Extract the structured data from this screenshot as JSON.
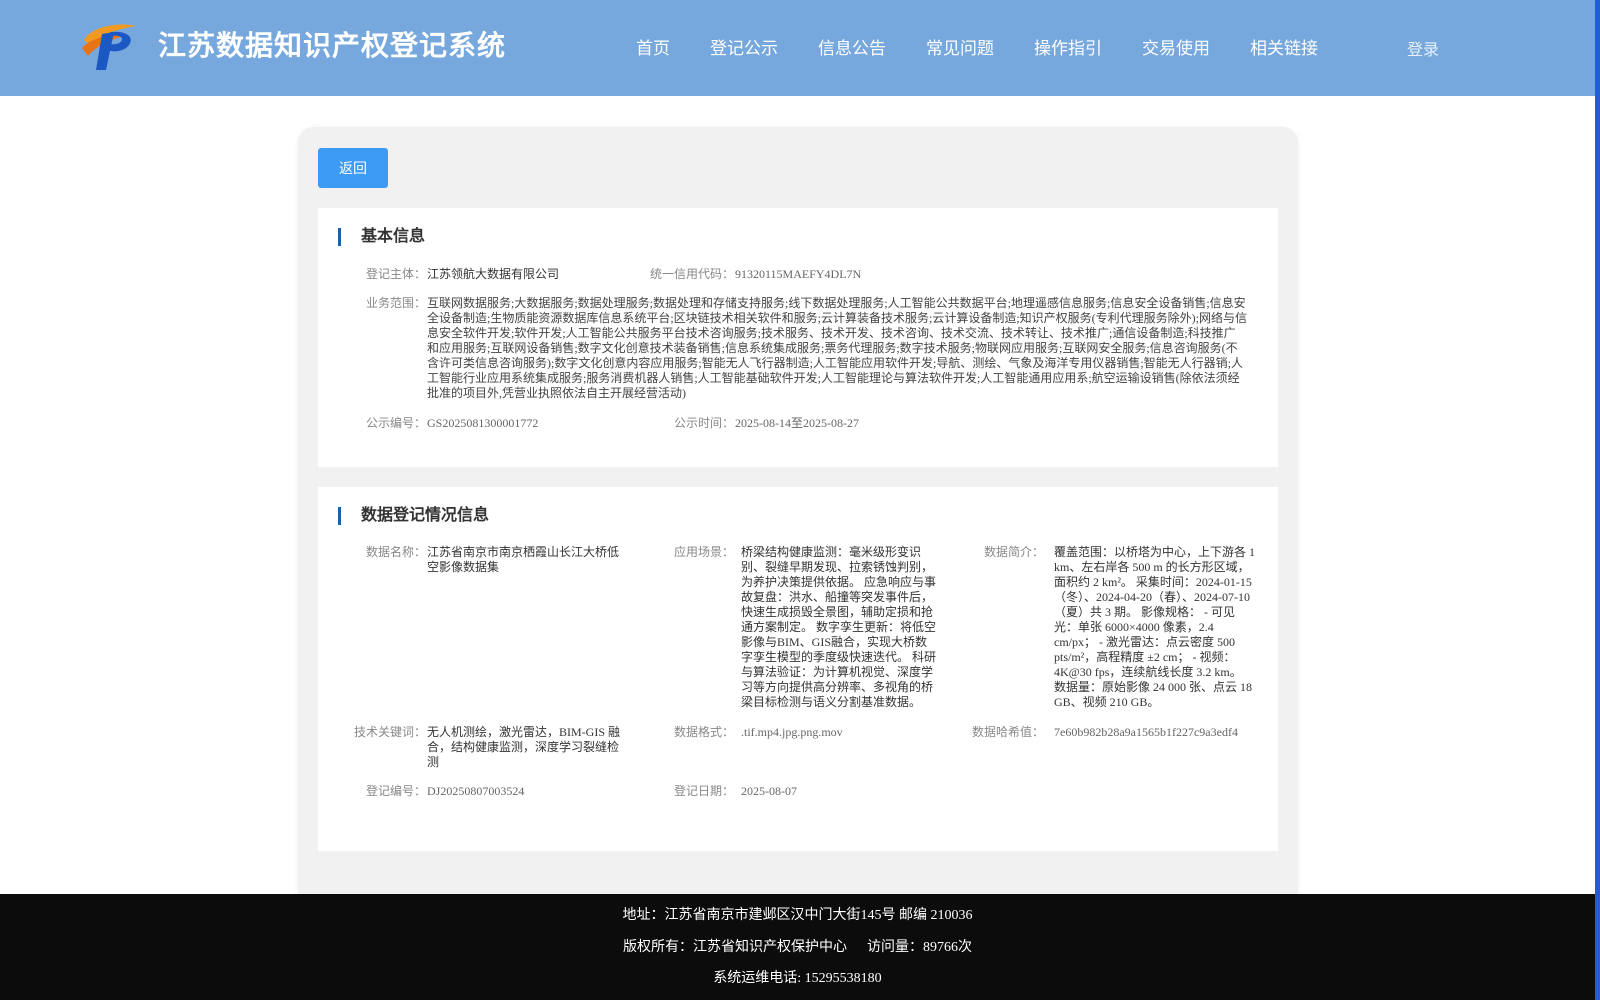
{
  "header": {
    "title": "江苏数据知识产权登记系统",
    "nav": [
      "首页",
      "登记公示",
      "信息公告",
      "常见问题",
      "操作指引",
      "交易使用",
      "相关链接"
    ],
    "login": "登录"
  },
  "back_button": "返回",
  "basic_info": {
    "title": "基本信息",
    "subject_label": "登记主体：",
    "subject_value": "江苏领航大数据有限公司",
    "credit_label": "统一信用代码：",
    "credit_value": "91320115MAEFY4DL7N",
    "scope_label": "业务范围：",
    "scope_value": "互联网数据服务;大数据服务;数据处理服务;数据处理和存储支持服务;线下数据处理服务;人工智能公共数据平台;地理遥感信息服务;信息安全设备销售;信息安全设备制造;生物质能资源数据库信息系统平台;区块链技术相关软件和服务;云计算装备技术服务;云计算设备制造;知识产权服务(专利代理服务除外);网络与信息安全软件开发;软件开发;人工智能公共服务平台技术咨询服务;技术服务、技术开发、技术咨询、技术交流、技术转让、技术推广;通信设备制造;科技推广和应用服务;互联网设备销售;数字文化创意技术装备销售;信息系统集成服务;票务代理服务;数字技术服务;物联网应用服务;互联网安全服务;信息咨询服务(不含许可类信息咨询服务);数字文化创意内容应用服务;智能无人飞行器制造;人工智能应用软件开发;导航、测绘、气象及海洋专用仪器销售;智能无人行器销;人工智能行业应用系统集成服务;服务消费机器人销售;人工智能基础软件开发;人工智能理论与算法软件开发;人工智能通用应用系;航空运输设销售(除依法须经批准的项目外,凭营业执照依法自主开展经营活动)",
    "notice_no_label": "公示编号：",
    "notice_no_value": "GS2025081300001772",
    "notice_time_label": "公示时间：",
    "notice_time_value": "2025-08-14至2025-08-27"
  },
  "registration_info": {
    "title": "数据登记情况信息",
    "name_label": "数据名称：",
    "name_value": "江苏省南京市南京栖霞山长江大桥低空影像数据集",
    "scenario_label": "应用场景：",
    "scenario_value": "桥梁结构健康监测：毫米级形变识别、裂缝早期发现、拉索锈蚀判别，为养护决策提供依据。 应急响应与事故复盘：洪水、船撞等突发事件后，快速生成损毁全景图，辅助定损和抢通方案制定。 数字孪生更新：将低空影像与BIM、GIS融合，实现大桥数字孪生模型的季度级快速迭代。 科研与算法验证：为计算机视觉、深度学习等方向提供高分辨率、多视角的桥梁目标检测与语义分割基准数据。",
    "intro_label": "数据简介：",
    "intro_value": "覆盖范围：以桥塔为中心，上下游各 1 km、左右岸各 500 m 的长方形区域，面积约 2 km²。 采集时间：2024-01-15（冬）、2024-04-20（春）、2024-07-10（夏）共 3 期。 影像规格：  - 可见光：单张 6000×4000 像素，2.4 cm/px；  - 激光雷达：点云密度 500 pts/m²，高程精度 ±2 cm；  - 视频：4K@30 fps，连续航线长度 3.2 km。 数据量：原始影像 24 000 张、点云 18 GB、视频 210 GB。",
    "keywords_label": "技术关键词：",
    "keywords_value": "无人机测绘，激光雷达，BIM-GIS 融合，结构健康监测，深度学习裂缝检测",
    "format_label": "数据格式：",
    "format_value": ".tif.mp4.jpg.png.mov",
    "hash_label": "数据哈希值：",
    "hash_value": "7e60b982b28a9a1565b1f227c9a3edf4",
    "reg_no_label": "登记编号：",
    "reg_no_value": "DJ20250807003524",
    "reg_date_label": "登记日期：",
    "reg_date_value": "2025-08-07"
  },
  "footer": {
    "address": "地址：江苏省南京市建邺区汉中门大街145号 邮编 210036",
    "copyright": "版权所有：江苏省知识产权保护中心",
    "visits": "访问量：89766次",
    "phone": "系统运维电话: 15295538180"
  },
  "colors": {
    "header_bg": "#77a8dd",
    "button_bg": "#3e9bf5",
    "accent_bar": "#1f5fa6",
    "footer_bg": "#0c0c0c"
  }
}
